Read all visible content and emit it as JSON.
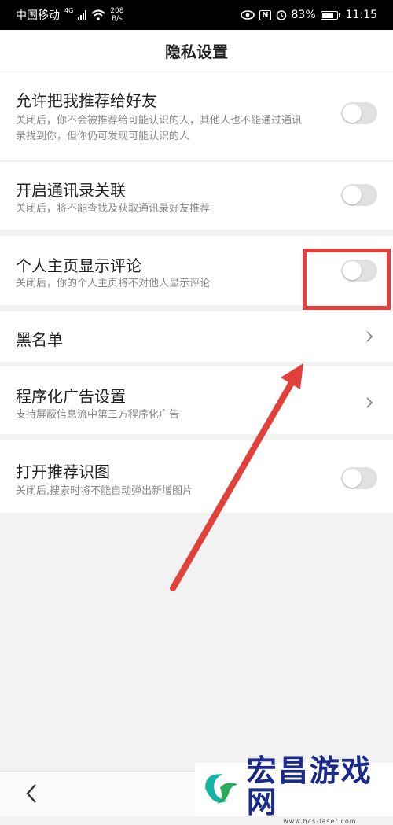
{
  "status_bar": {
    "carrier": "中国移动",
    "network": "4G",
    "speed_value": "208",
    "speed_unit": "B/s",
    "nfc": "N",
    "battery": "83%",
    "battery_level": 0.83,
    "time": "11:15"
  },
  "header": {
    "title": "隐私设置"
  },
  "settings": [
    {
      "label": "允许把我推荐给好友",
      "desc": "关闭后，你不会被推荐给可能认识的人，其他人也不能通过通讯录找到你，但你仍可发现可能认识的人",
      "control": "toggle",
      "enabled": false
    },
    {
      "label": "开启通讯录关联",
      "desc": "关闭后，将不能查找及获取通讯录好友推荐",
      "control": "toggle",
      "enabled": false
    },
    {
      "label": "个人主页显示评论",
      "desc": "关闭后，你的个人主页将不对他人显示评论",
      "control": "toggle",
      "enabled": false
    },
    {
      "label": "黑名单",
      "control": "chevron"
    },
    {
      "label": "程序化广告设置",
      "desc": "支持屏蔽信息流中第三方程序化广告",
      "control": "chevron"
    },
    {
      "label": "打开推荐识图",
      "desc": "关闭后,搜索时将不能自动弹出新增图片",
      "control": "toggle",
      "enabled": false
    }
  ],
  "nav": {
    "back_icon": "chevron-left-icon"
  },
  "watermark": {
    "text": "宏昌游戏网",
    "url": "www.hcs-laser.com"
  },
  "colors": {
    "annotation": "#e2403a",
    "toggle_off": "#e1e1e1",
    "watermark_text": "#1a2b8c"
  }
}
